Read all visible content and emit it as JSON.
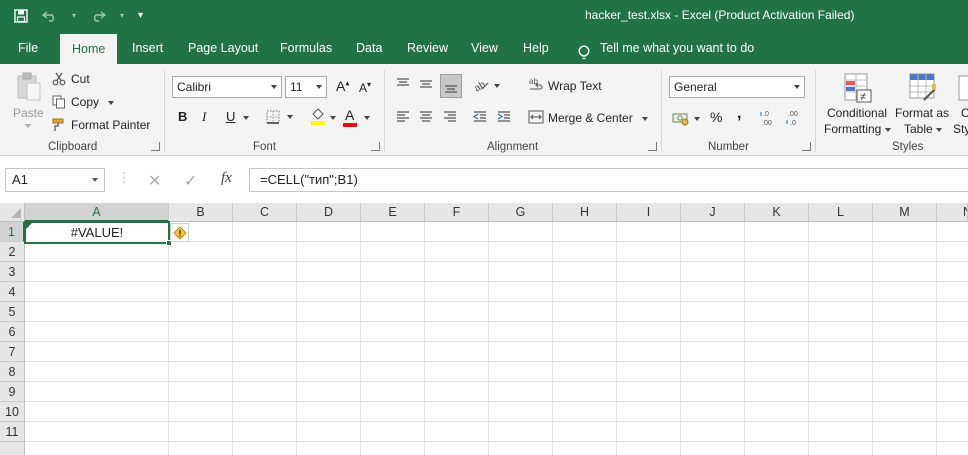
{
  "titlebar": {
    "title": "hacker_test.xlsx  -  Excel (Product Activation Failed)"
  },
  "tabs": [
    {
      "label": "File"
    },
    {
      "label": "Home",
      "active": true
    },
    {
      "label": "Insert"
    },
    {
      "label": "Page Layout"
    },
    {
      "label": "Formulas"
    },
    {
      "label": "Data"
    },
    {
      "label": "Review"
    },
    {
      "label": "View"
    },
    {
      "label": "Help"
    }
  ],
  "tell_me": "Tell me what you want to do",
  "ribbon": {
    "clipboard": {
      "label": "Clipboard",
      "paste": "Paste",
      "cut": "Cut",
      "copy": "Copy",
      "format_painter": "Format Painter"
    },
    "font": {
      "label": "Font",
      "font_name": "Calibri",
      "font_size": "11",
      "bold": "B",
      "italic": "I",
      "underline": "U",
      "grow": "A",
      "shrink": "A",
      "font_color_letter": "A"
    },
    "alignment": {
      "label": "Alignment",
      "wrap_text": "Wrap Text",
      "merge_center": "Merge & Center"
    },
    "number": {
      "label": "Number",
      "format": "General",
      "percent": "%",
      "comma": ","
    },
    "styles": {
      "label": "Styles",
      "conditional_1": "Conditional",
      "conditional_2": "Formatting",
      "format_as_1": "Format as",
      "format_as_2": "Table",
      "cell_styles_1": "C",
      "cell_styles_2": "Sty"
    }
  },
  "formula_bar": {
    "name_box": "A1",
    "fx": "fx",
    "formula": "=CELL(\"тип\";B1)"
  },
  "sheet": {
    "columns": [
      "A",
      "B",
      "C",
      "D",
      "E",
      "F",
      "G",
      "H",
      "I",
      "J",
      "K",
      "L",
      "M",
      "N"
    ],
    "rows": [
      "1",
      "2",
      "3",
      "4",
      "5",
      "6",
      "7",
      "8",
      "9",
      "10",
      "11"
    ],
    "active_cell_value": "#VALUE!"
  },
  "colors": {
    "accent": "#217346"
  }
}
